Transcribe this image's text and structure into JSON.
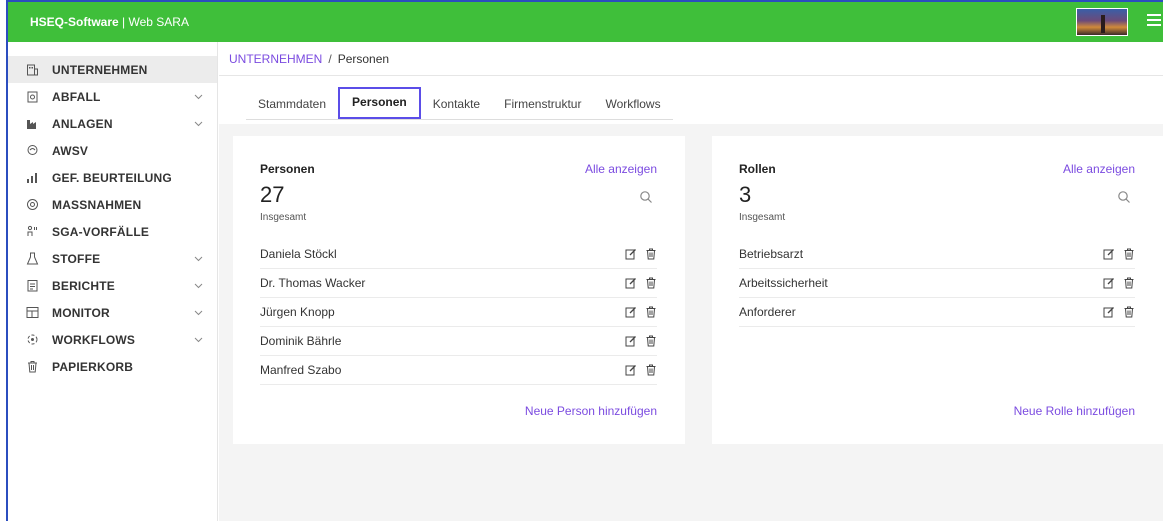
{
  "brand": {
    "name": "HSEQ-Software",
    "separator": " | ",
    "product": "Web SARA"
  },
  "sidebar": {
    "items": [
      {
        "label": "UNTERNEHMEN",
        "icon": "building-icon",
        "active": true,
        "has_children": false
      },
      {
        "label": "ABFALL",
        "icon": "waste-icon",
        "active": false,
        "has_children": true
      },
      {
        "label": "ANLAGEN",
        "icon": "factory-icon",
        "active": false,
        "has_children": true
      },
      {
        "label": "AWSV",
        "icon": "water-icon",
        "active": false,
        "has_children": false
      },
      {
        "label": "GEF. BEURTEILUNG",
        "icon": "hazard-icon",
        "active": false,
        "has_children": false
      },
      {
        "label": "MASSNAHMEN",
        "icon": "measures-icon",
        "active": false,
        "has_children": false
      },
      {
        "label": "SGA-VORFÄLLE",
        "icon": "incident-icon",
        "active": false,
        "has_children": false
      },
      {
        "label": "STOFFE",
        "icon": "flask-icon",
        "active": false,
        "has_children": true
      },
      {
        "label": "BERICHTE",
        "icon": "report-icon",
        "active": false,
        "has_children": true
      },
      {
        "label": "MONITOR",
        "icon": "monitor-icon",
        "active": false,
        "has_children": true
      },
      {
        "label": "WORKFLOWS",
        "icon": "workflow-icon",
        "active": false,
        "has_children": true
      },
      {
        "label": "PAPIERKORB",
        "icon": "trash-icon",
        "active": false,
        "has_children": false
      }
    ]
  },
  "breadcrumb": {
    "parent": "UNTERNEHMEN",
    "separator": "/",
    "current": "Personen"
  },
  "tabs": [
    {
      "label": "Stammdaten",
      "active": false
    },
    {
      "label": "Personen",
      "active": true
    },
    {
      "label": "Kontakte",
      "active": false
    },
    {
      "label": "Firmenstruktur",
      "active": false
    },
    {
      "label": "Workflows",
      "active": false
    }
  ],
  "personen_card": {
    "title": "Personen",
    "show_all": "Alle anzeigen",
    "count": "27",
    "count_label": "Insgesamt",
    "rows": [
      "Daniela Stöckl",
      "Dr. Thomas Wacker",
      "Jürgen Knopp",
      "Dominik Bährle",
      "Manfred Szabo"
    ],
    "add_label": "Neue Person hinzufügen"
  },
  "rollen_card": {
    "title": "Rollen",
    "show_all": "Alle anzeigen",
    "count": "3",
    "count_label": "Insgesamt",
    "rows": [
      "Betriebsarzt",
      "Arbeitssicherheit",
      "Anforderer"
    ],
    "add_label": "Neue Rolle hinzufügen"
  },
  "colors": {
    "header_green": "#3fbf3a",
    "accent_purple": "#7b4be0",
    "active_tab_border": "#5b4de8"
  }
}
